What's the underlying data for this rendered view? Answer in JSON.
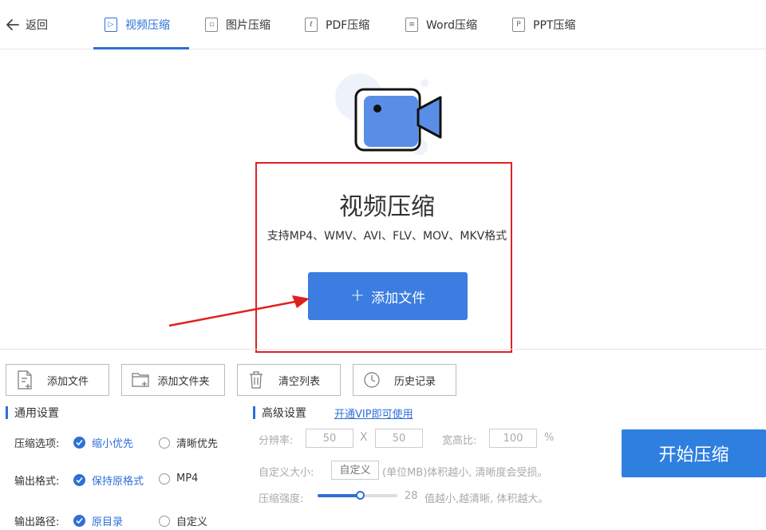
{
  "nav": {
    "back_label": "返回",
    "tabs": [
      {
        "label": "视频压缩",
        "icon": "video-doc-icon",
        "active": true
      },
      {
        "label": "图片压缩",
        "icon": "image-doc-icon",
        "active": false
      },
      {
        "label": "PDF压缩",
        "icon": "pdf-doc-icon",
        "active": false
      },
      {
        "label": "Word压缩",
        "icon": "word-doc-icon",
        "active": false
      },
      {
        "label": "PPT压缩",
        "icon": "ppt-doc-icon",
        "active": false
      }
    ]
  },
  "hero": {
    "title": "视频压缩",
    "subtitle": "支持MP4、WMV、AVI、FLV、MOV、MKV格式",
    "add_button": "添加文件"
  },
  "toolbar": {
    "add_file": "添加文件",
    "add_folder": "添加文件夹",
    "clear_list": "清空列表",
    "history": "历史记录"
  },
  "general": {
    "title": "通用设置",
    "compress_label": "压缩选项:",
    "compress_options": [
      "缩小优先",
      "清晰优先"
    ],
    "compress_selected": 0,
    "format_label": "输出格式:",
    "format_options": [
      "保持原格式",
      "MP4"
    ],
    "format_selected": 0,
    "path_label": "输出路径:",
    "path_options": [
      "原目录",
      "自定义"
    ],
    "path_selected": 0
  },
  "advanced": {
    "title": "高级设置",
    "vip_link": "开通VIP即可使用",
    "resolution_label": "分辨率:",
    "resolution_w": "50",
    "resolution_sep": "X",
    "resolution_h": "50",
    "aspect_label": "宽高比:",
    "aspect_value": "100",
    "aspect_unit": "%",
    "custom_size_label": "自定义大小:",
    "custom_size_placeholder": "自定义",
    "custom_size_hint": "(单位MB)体积越小, 清晰度会受损。",
    "strength_label": "压缩强度:",
    "strength_value": "28",
    "strength_fraction": 0.53,
    "strength_hint": "值越小,越清晰, 体积越大。"
  },
  "start_button": "开始压缩",
  "colors": {
    "accent": "#2e6fd8",
    "primary_button": "#3b7de0",
    "highlight_box": "#e02020"
  }
}
